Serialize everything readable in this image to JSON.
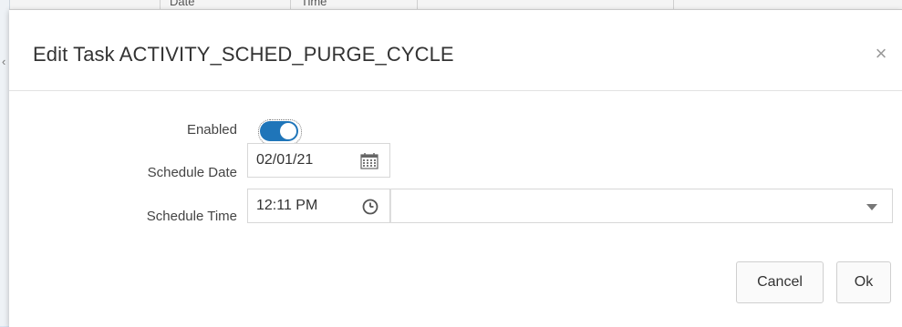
{
  "background_table": {
    "column_1_header": "Date",
    "column_2_header": "Time"
  },
  "dialog": {
    "title": "Edit Task ACTIVITY_SCHED_PURGE_CYCLE",
    "close_glyph": "×"
  },
  "form": {
    "enabled_label": "Enabled",
    "enabled_value": true,
    "schedule_date_label": "Schedule Date",
    "schedule_date_value": "02/01/21",
    "schedule_time_label": "Schedule Time",
    "schedule_time_value": "12:11 PM",
    "timezone_value": ""
  },
  "buttons": {
    "cancel_label": "Cancel",
    "ok_label": "Ok"
  },
  "icons": {
    "calendar": "calendar-icon",
    "clock": "clock-icon",
    "dropdown": "chevron-down-icon",
    "close": "close-icon"
  },
  "colors": {
    "toggle_on": "#1f75b9",
    "page_background": "#d6e4f2"
  }
}
